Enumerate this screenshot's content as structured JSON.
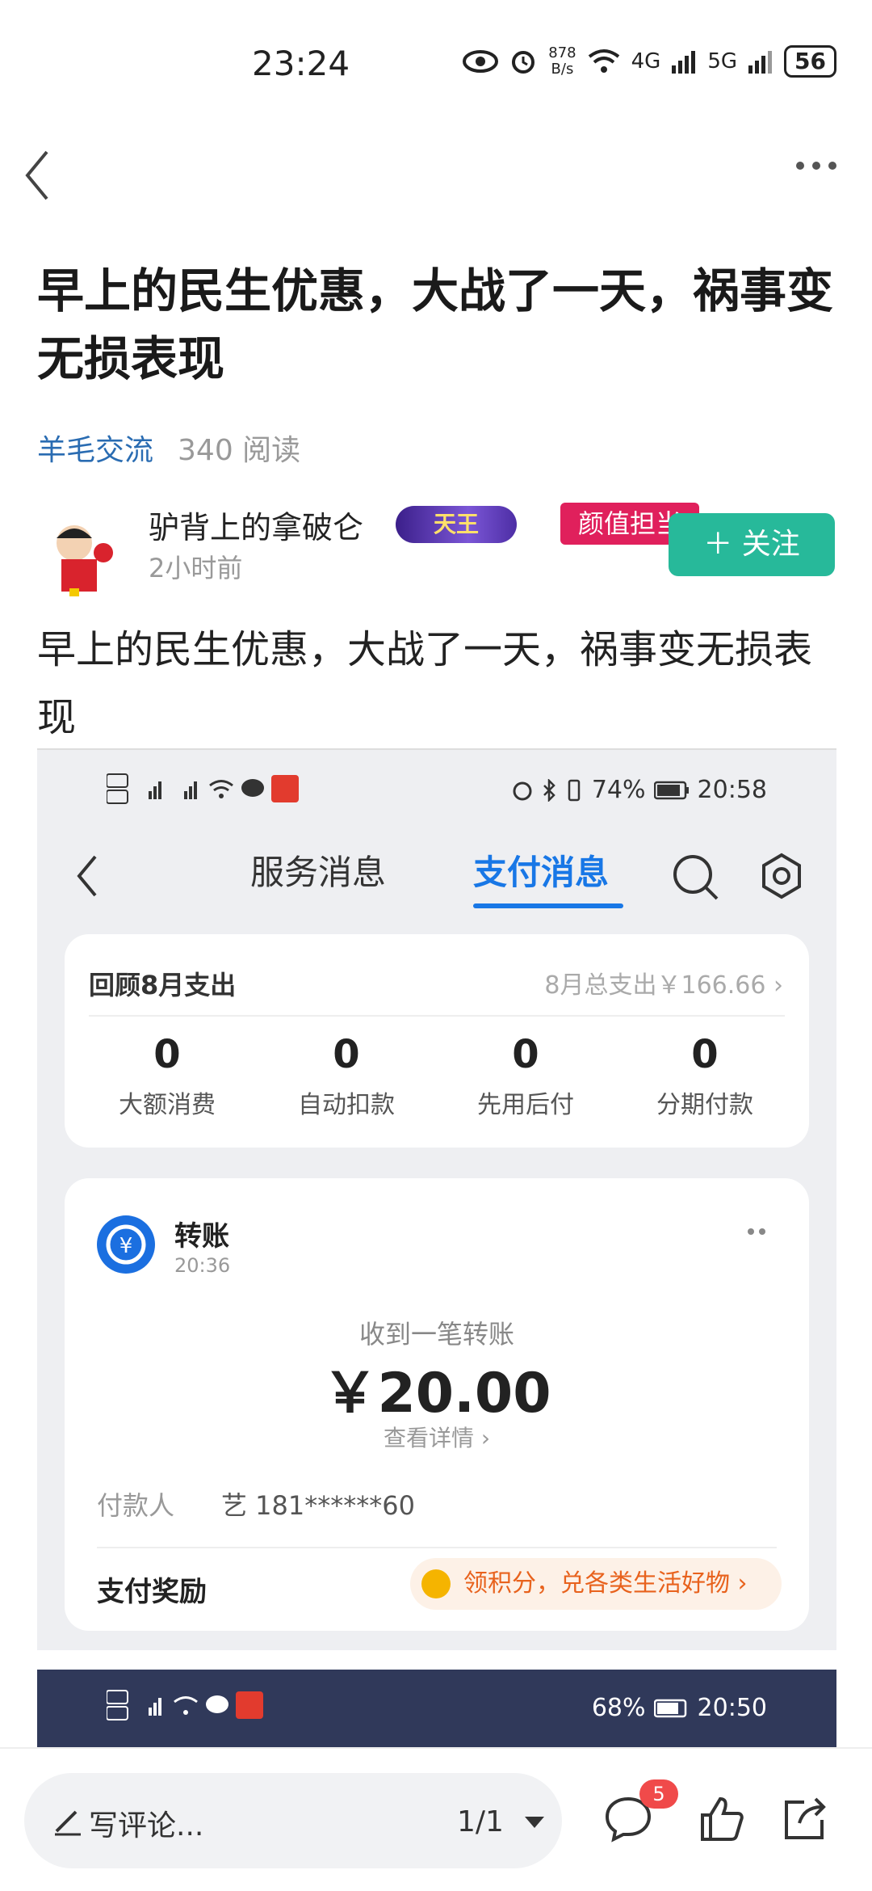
{
  "status_bar": {
    "time": "23:24",
    "speed_top": "878",
    "speed_bottom": "B/s",
    "net1": "4G",
    "net2": "5G",
    "battery": "56"
  },
  "article": {
    "title": "早上的民生优惠，大战了一天，祸事变无损表现",
    "category": "羊毛交流",
    "reads": "340 阅读",
    "author_name": "驴背上的拿破仑",
    "badge_king": "天王",
    "badge_face": "颜值担当",
    "posted": "2小时前",
    "follow": "＋ 关注",
    "body": "早上的民生优惠，大战了一天，祸事变无损表现"
  },
  "embedded": {
    "status": {
      "battery": "74%",
      "time": "20:58"
    },
    "tab_service": "服务消息",
    "tab_payment": "支付消息",
    "review": {
      "title": "回顾8月支出",
      "total": "8月总支出￥166.66",
      "stats": [
        {
          "value": "0",
          "label": "大额消费"
        },
        {
          "value": "0",
          "label": "自动扣款"
        },
        {
          "value": "0",
          "label": "先用后付"
        },
        {
          "value": "0",
          "label": "分期付款"
        }
      ]
    },
    "transfer": {
      "title": "转账",
      "time": "20:36",
      "received": "收到一笔转账",
      "amount": "￥20.00",
      "detail": "查看详情",
      "payer_label": "付款人",
      "payer_value": "艺 181******60",
      "reward_label": "支付奖励",
      "reward_text": "领积分，兑各类生活好物"
    },
    "status2": {
      "battery": "68%",
      "time": "20:50"
    }
  },
  "bottom": {
    "comment_placeholder": "写评论...",
    "page": "1/1",
    "comment_count": "5"
  }
}
